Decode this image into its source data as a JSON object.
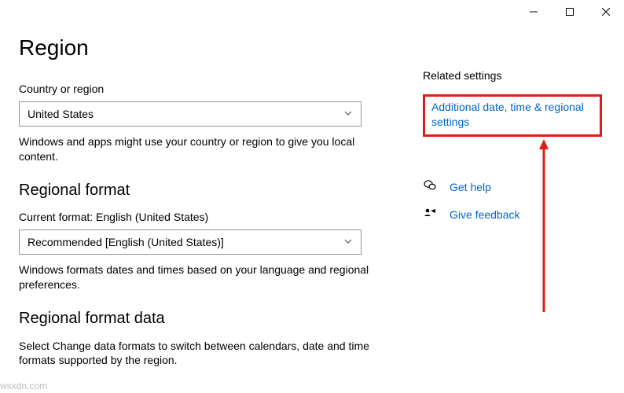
{
  "page": {
    "title": "Region"
  },
  "country": {
    "label": "Country or region",
    "value": "United States",
    "desc": "Windows and apps might use your country or region to give you local content."
  },
  "format": {
    "heading": "Regional format",
    "label": "Current format: English (United States)",
    "value": "Recommended [English (United States)]",
    "desc": "Windows formats dates and times based on your language and regional preferences."
  },
  "format_data": {
    "heading": "Regional format data",
    "desc": "Select Change data formats to switch between calendars, date and time formats supported by the region."
  },
  "side": {
    "heading": "Related settings",
    "additional": "Additional date, time & regional settings",
    "help": "Get help",
    "feedback": "Give feedback"
  },
  "watermark": "wsxdn.com"
}
